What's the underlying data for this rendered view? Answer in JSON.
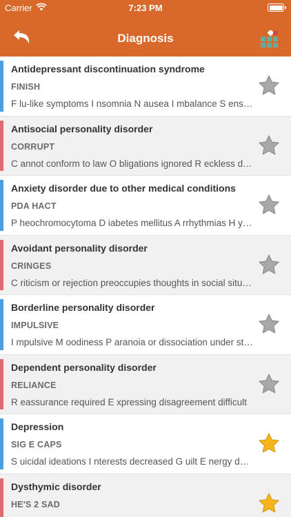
{
  "status_bar": {
    "carrier": "Carrier",
    "time": "7:23 PM"
  },
  "nav": {
    "title": "Diagnosis"
  },
  "colors": {
    "header": "#d9692a",
    "bar_blue": "#4b9fdc",
    "bar_red": "#dd6b70",
    "star_grey": "#a8a8a8",
    "star_gold": "#f5b51c"
  },
  "items": [
    {
      "name": "Antidepressant discontinuation syndrome",
      "mnemonic": "FINISH",
      "description": "F lu-like symptoms  I nsomnia  N ausea  I mbalance  S ensory disturbances  H yperarousal",
      "bar": "blue",
      "starred": false
    },
    {
      "name": "Antisocial personality disorder",
      "mnemonic": "CORRUPT",
      "description": "C annot conform to law  O bligations ignored  R eckless disregard for safety",
      "bar": "red",
      "starred": false
    },
    {
      "name": "Anxiety disorder due to other medical conditions",
      "mnemonic": "PDA HACT",
      "description": "P heochromocytoma  D iabetes mellitus  A rrhythmias  H yperthyroidism",
      "bar": "blue",
      "starred": false
    },
    {
      "name": "Avoidant personality disorder",
      "mnemonic": "CRINGES",
      "description": "C riticism or rejection preoccupies thoughts in social situations",
      "bar": "red",
      "starred": false
    },
    {
      "name": "Borderline personality disorder",
      "mnemonic": "IMPULSIVE",
      "description": "I mpulsive  M oodiness  P aranoia or dissociation under stress",
      "bar": "blue",
      "starred": false
    },
    {
      "name": "Dependent personality disorder",
      "mnemonic": "RELIANCE",
      "description": "R eassurance required  E xpressing disagreement difficult",
      "bar": "red",
      "starred": false
    },
    {
      "name": "Depression",
      "mnemonic": "SIG E CAPS",
      "description": "S uicidal ideations  I nterests decreased  G uilt  E nergy decreased",
      "bar": "blue",
      "starred": true
    },
    {
      "name": "Dysthymic disorder",
      "mnemonic": "HE'S 2 SAD",
      "description": "",
      "bar": "red",
      "starred": true
    }
  ]
}
